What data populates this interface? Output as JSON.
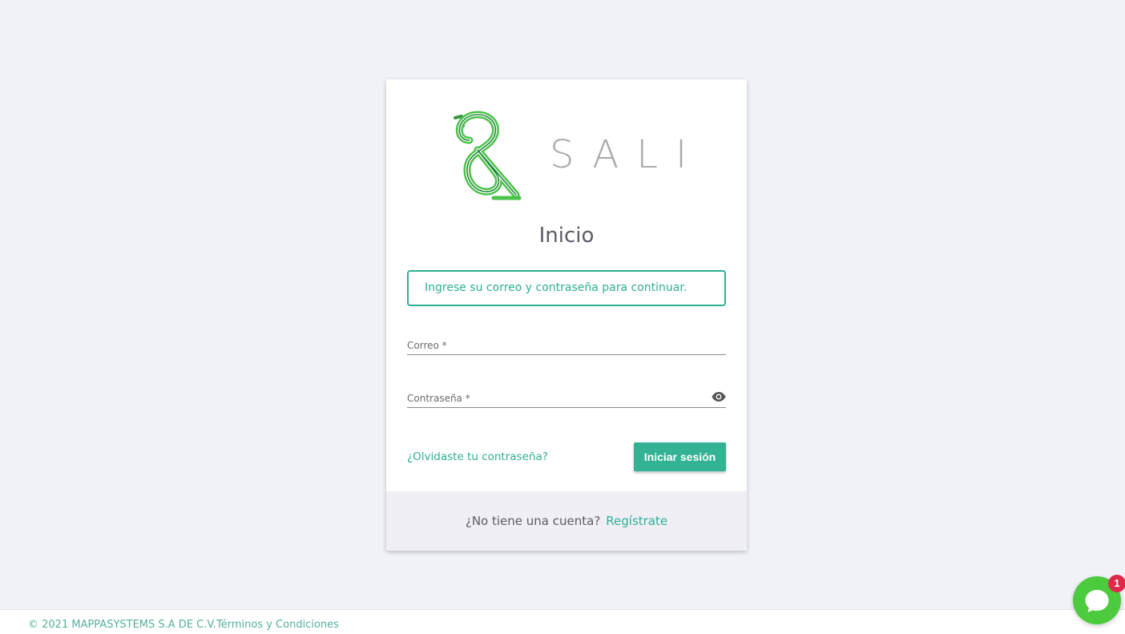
{
  "brand": {
    "wordmark": "SALI",
    "primary_color": "#33b294",
    "logo_green": "#4cc24a"
  },
  "login": {
    "title": "Inicio",
    "alert_text": "Ingrese su correo y contraseña para continuar.",
    "email_label": "Correo *",
    "password_label": "Contraseña *",
    "forgot_label": "¿Olvidaste tu contraseña?",
    "submit_label": "Iniciar sesión",
    "no_account_text": "¿No tiene una cuenta?",
    "register_label": "Regístrate",
    "password_toggle_icon": "eye-icon"
  },
  "footer": {
    "copyright": "© 2021 MAPPASYSTEMS S.A DE C.V.",
    "terms_label": "Términos y Condiciones"
  },
  "chat_widget": {
    "icon": "chat-bubble-icon",
    "badge_count": "1",
    "color": "#4dcb3f"
  }
}
